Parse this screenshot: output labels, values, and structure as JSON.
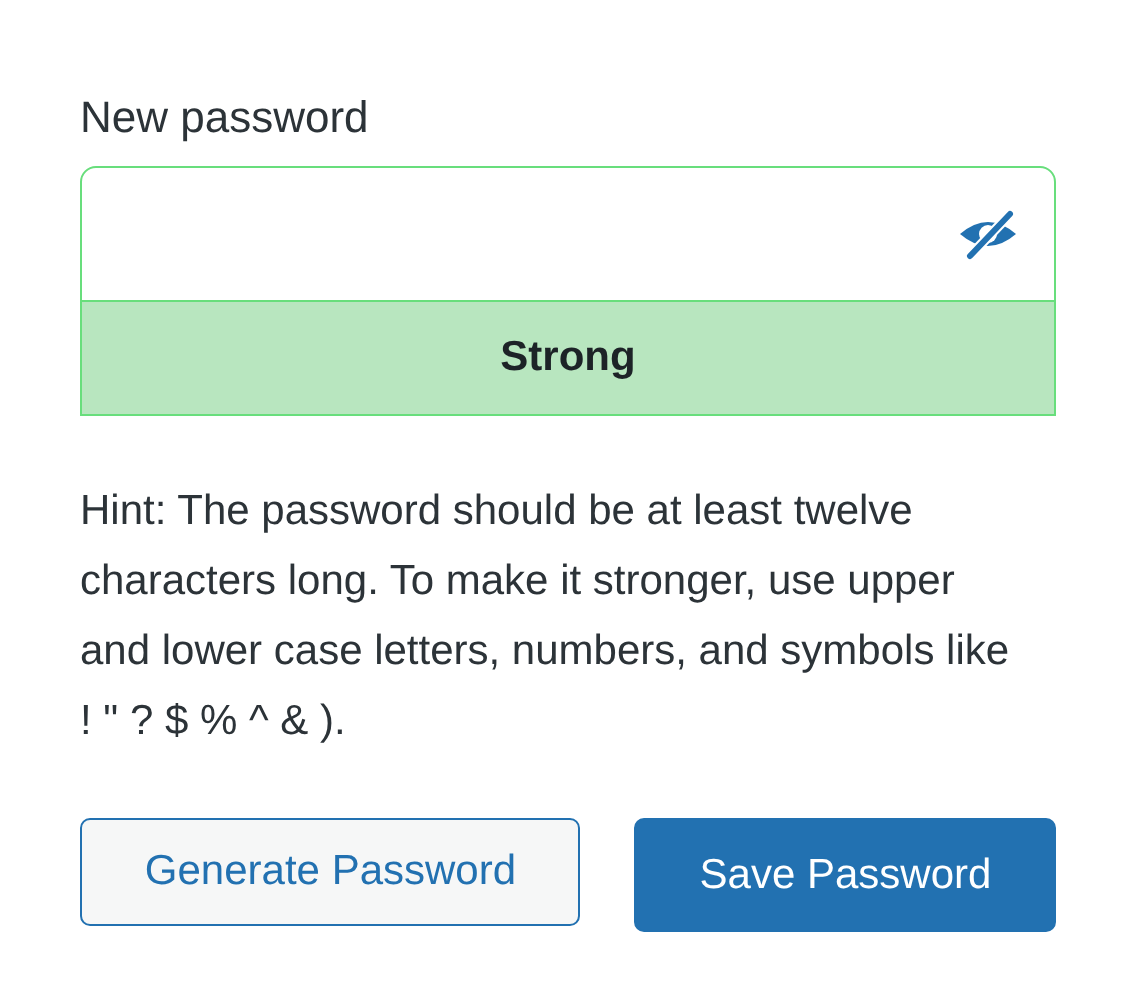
{
  "password_field": {
    "label": "New password",
    "strength": {
      "kind": "strong",
      "text": "Strong"
    }
  },
  "hint": "Hint: The password should be at least twelve characters long. To make it stronger, use upper and lower case letters, numbers, and symbols like ! \" ? $ % ^ & ).",
  "buttons": [
    {
      "label": "Generate Password",
      "kind": "secondary"
    },
    {
      "label": "Save Password",
      "kind": "primary"
    }
  ]
}
